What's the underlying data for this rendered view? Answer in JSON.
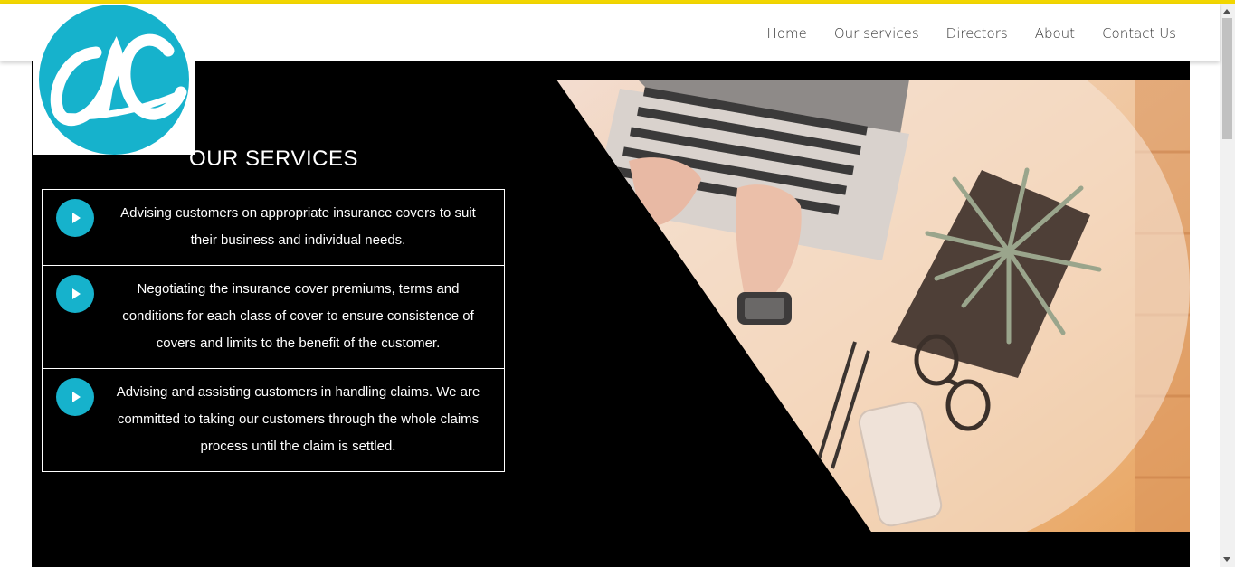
{
  "nav": {
    "items": [
      {
        "label": "Home"
      },
      {
        "label": "Our services"
      },
      {
        "label": "Directors"
      },
      {
        "label": "About"
      },
      {
        "label": "Contact Us"
      }
    ]
  },
  "logo": {
    "icon": "ac-logo-icon",
    "text": "ac",
    "color": "#16b2cc"
  },
  "services": {
    "title": "OUR SERVICES",
    "items": [
      {
        "text": "Advising customers on appropriate insurance covers to suit their business and individual needs.",
        "icon": "play-icon"
      },
      {
        "text": "Negotiating the insurance cover premiums, terms and conditions for each class of cover to ensure consistence of covers and limits to the benefit of the customer.",
        "icon": "play-icon"
      },
      {
        "text": "Advising and assisting customers in handling claims. We are committed to taking our customers through the whole claims process until the claim is settled.",
        "icon": "play-icon"
      }
    ]
  },
  "colors": {
    "accent": "#16b2cc",
    "hero_bg": "#000000",
    "top_bar": "#f2d600"
  }
}
